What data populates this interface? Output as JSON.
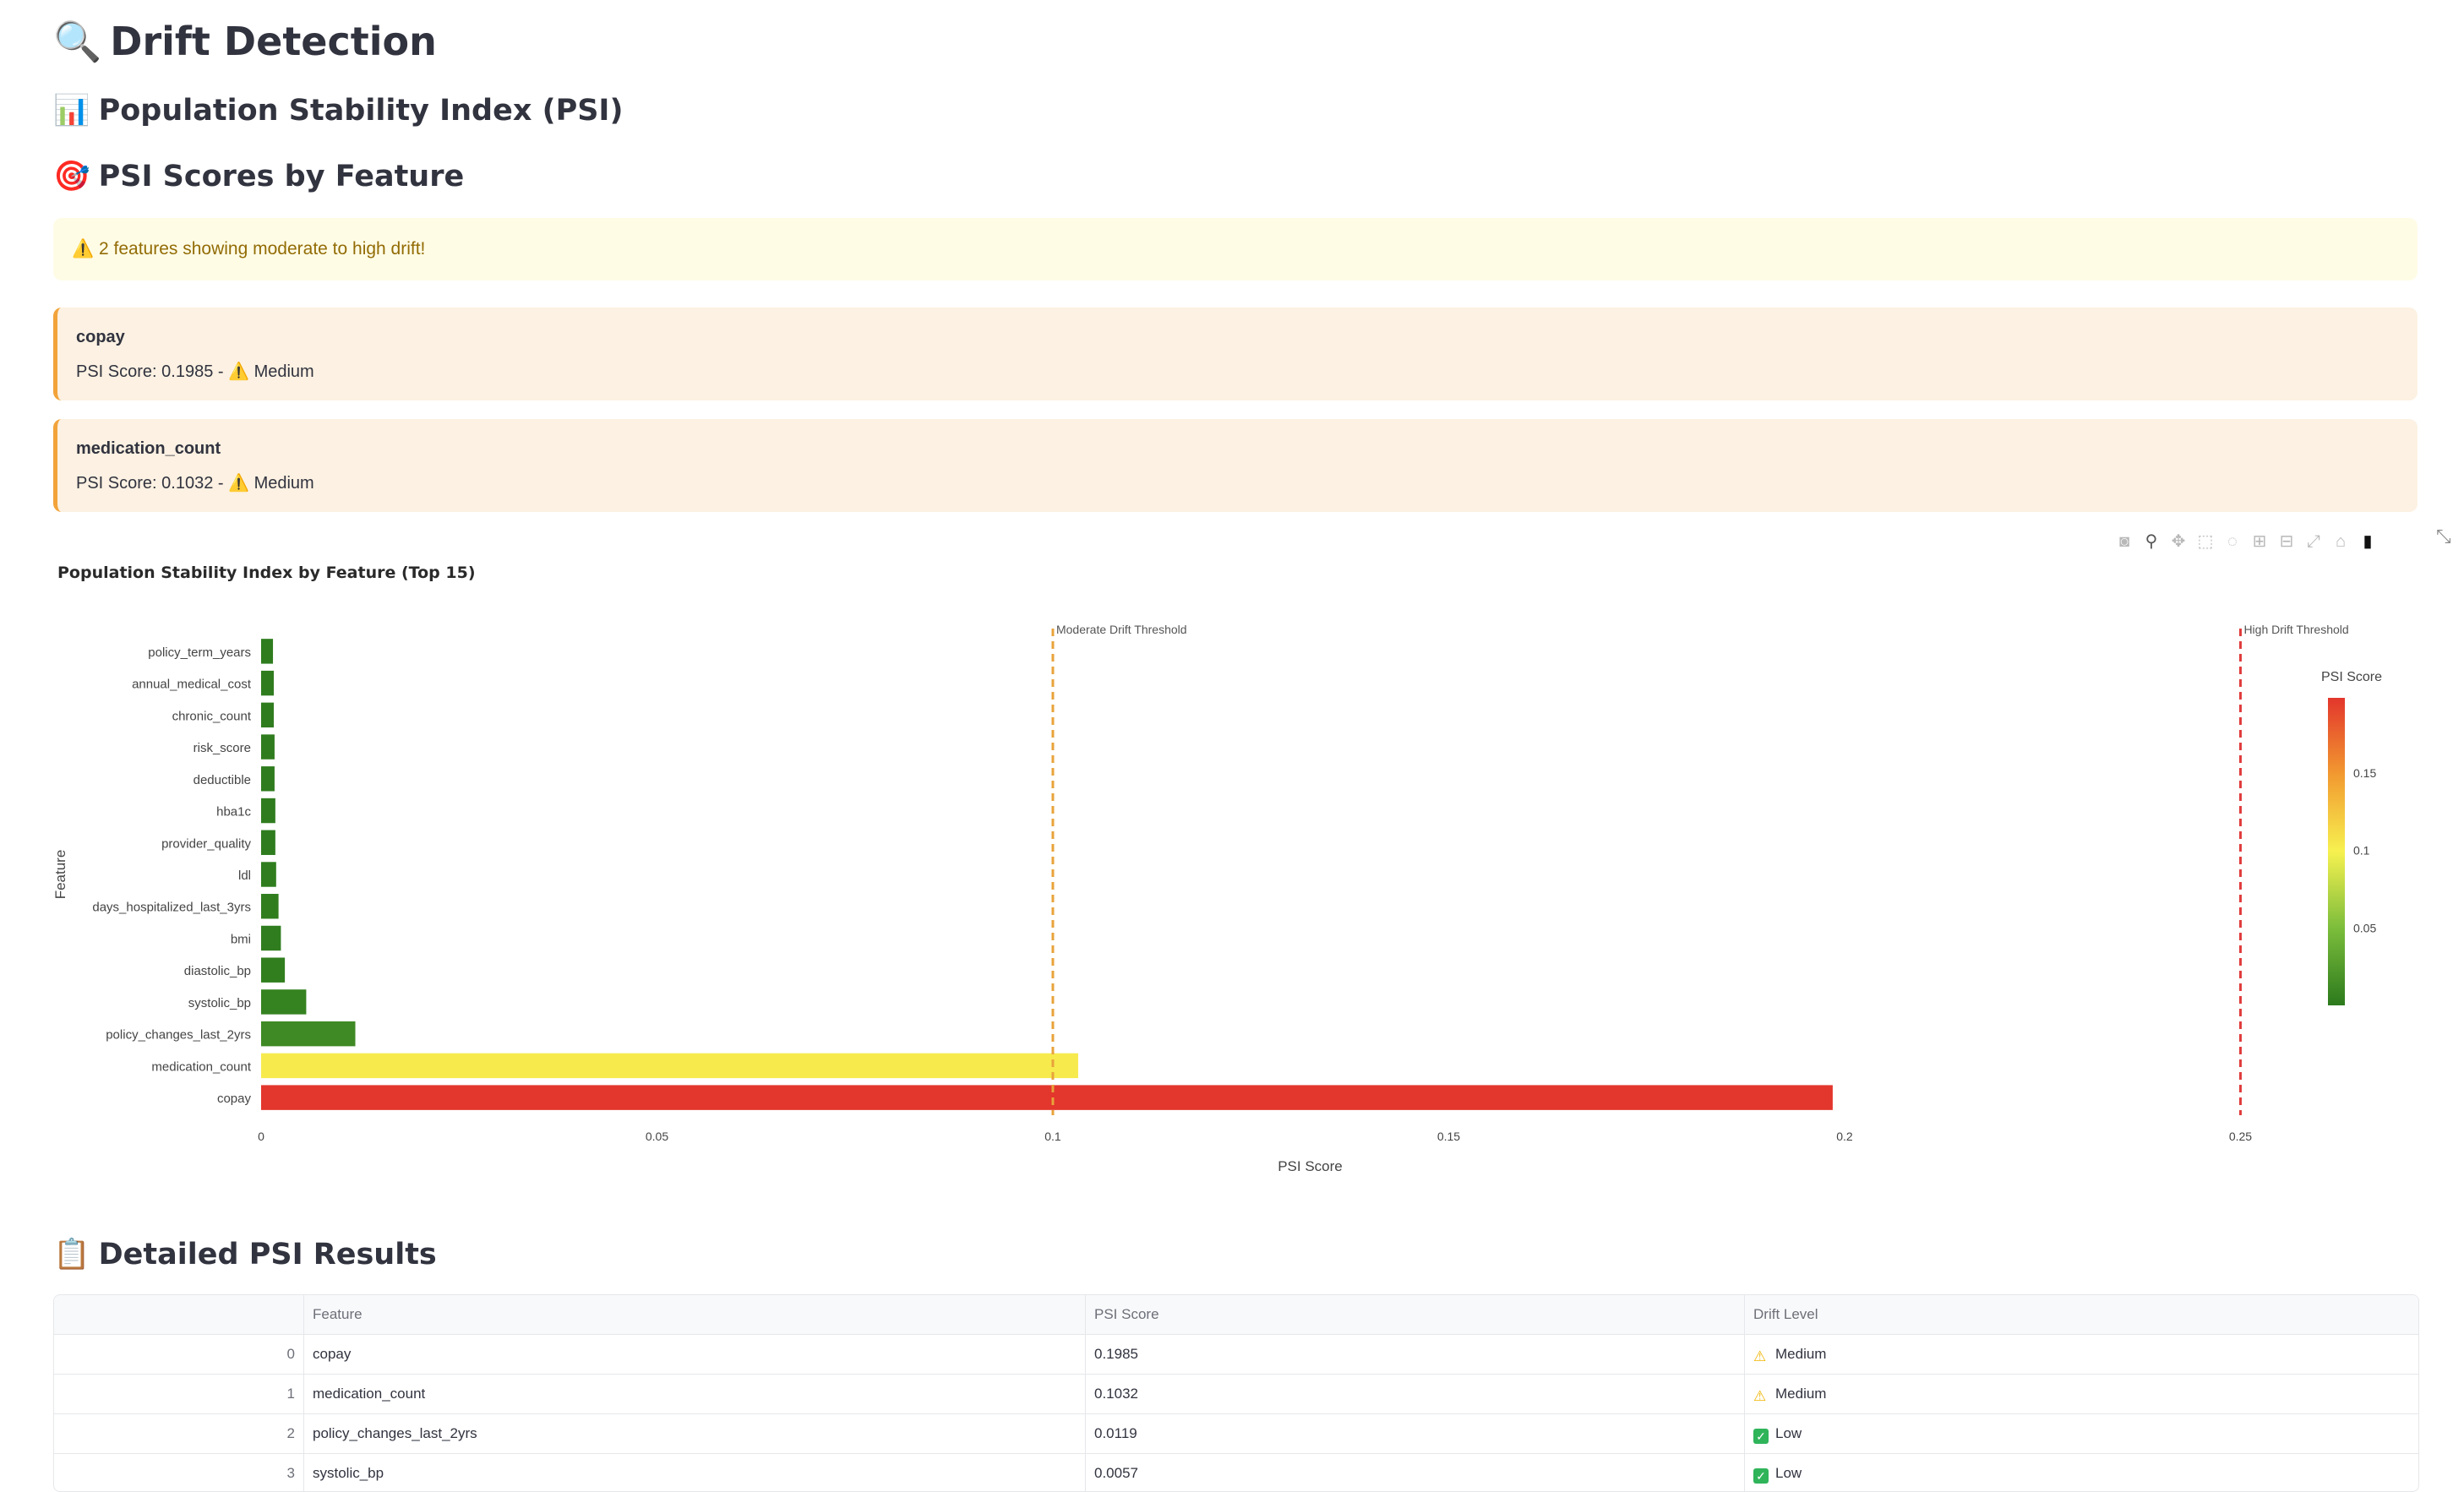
{
  "page": {
    "title": "Drift Detection",
    "title_icon": "magnifier-icon",
    "section_psi": "Population Stability Index (PSI)",
    "section_psi_icon": "bar-chart-icon",
    "section_scores": "PSI Scores by Feature",
    "section_scores_icon": "target-icon",
    "section_details": "Detailed PSI Results",
    "section_details_icon": "clipboard-icon"
  },
  "alert": {
    "text": "2 features showing moderate to high drift!",
    "icon": "warning-icon",
    "color": "#926c05"
  },
  "drift_cards": [
    {
      "feature": "copay",
      "score_text": "PSI Score: 0.1985 - ",
      "level": "Medium",
      "icon": "warning-icon"
    },
    {
      "feature": "medication_count",
      "score_text": "PSI Score: 0.1032 - ",
      "level": "Medium",
      "icon": "warning-icon"
    }
  ],
  "modebar": [
    "camera-icon",
    "zoom-icon",
    "pan-icon",
    "box-select-icon",
    "lasso-icon",
    "zoom-in-icon",
    "zoom-out-icon",
    "autoscale-icon",
    "reset-icon",
    "plotly-logo-icon"
  ],
  "chart_data": {
    "type": "bar",
    "orientation": "horizontal",
    "title": "Population Stability Index by Feature (Top 15)",
    "xlabel": "PSI Score",
    "ylabel": "Feature",
    "xlim": [
      0,
      0.265
    ],
    "xticks": [
      "0",
      "0.05",
      "0.1",
      "0.15",
      "0.2",
      "0.25"
    ],
    "xtick_values": [
      0,
      0.05,
      0.1,
      0.15,
      0.2,
      0.25
    ],
    "categories": [
      "policy_term_years",
      "annual_medical_cost",
      "chronic_count",
      "risk_score",
      "deductible",
      "hba1c",
      "provider_quality",
      "ldl",
      "days_hospitalized_last_3yrs",
      "bmi",
      "diastolic_bp",
      "systolic_bp",
      "policy_changes_last_2yrs",
      "medication_count",
      "copay"
    ],
    "values": [
      0.0015,
      0.0016,
      0.0016,
      0.0017,
      0.0017,
      0.0018,
      0.0018,
      0.0019,
      0.0022,
      0.0025,
      0.003,
      0.0057,
      0.0119,
      0.1032,
      0.1985
    ],
    "thresholds": [
      {
        "label": "Moderate Drift Threshold",
        "value": 0.1,
        "color": "#e8a33b"
      },
      {
        "label": "High Drift Threshold",
        "value": 0.25,
        "color": "#e03c3c"
      }
    ],
    "colorbar": {
      "title": "PSI Score",
      "ticks": [
        "0.05",
        "0.1",
        "0.15"
      ],
      "tick_values": [
        0.05,
        0.1,
        0.15
      ],
      "range": [
        0,
        0.1985
      ],
      "colors": [
        "#2c7a1d",
        "#7bbd3b",
        "#f7f150",
        "#f29a30",
        "#e3362c"
      ]
    },
    "grid": false,
    "legend": "none"
  },
  "table": {
    "columns": [
      "",
      "Feature",
      "PSI Score",
      "Drift Level"
    ],
    "rows": [
      {
        "index": "0",
        "feature": "copay",
        "psi": "0.1985",
        "level": "Medium",
        "level_icon": "warning-icon"
      },
      {
        "index": "1",
        "feature": "medication_count",
        "psi": "0.1032",
        "level": "Medium",
        "level_icon": "warning-icon"
      },
      {
        "index": "2",
        "feature": "policy_changes_last_2yrs",
        "psi": "0.0119",
        "level": "Low",
        "level_icon": "check-icon"
      },
      {
        "index": "3",
        "feature": "systolic_bp",
        "psi": "0.0057",
        "level": "Low",
        "level_icon": "check-icon"
      }
    ]
  }
}
